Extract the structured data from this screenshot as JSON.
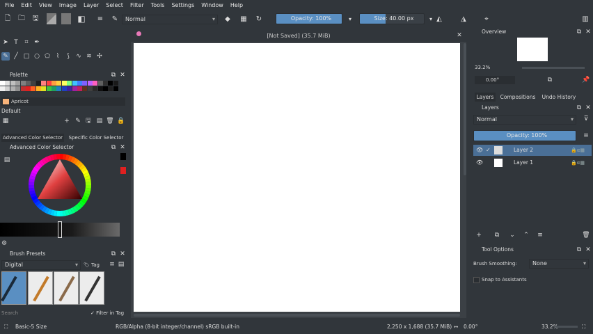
{
  "menu": [
    "File",
    "Edit",
    "View",
    "Image",
    "Layer",
    "Select",
    "Filter",
    "Tools",
    "Settings",
    "Window",
    "Help"
  ],
  "toolbar": {
    "blend_mode": "Normal",
    "opacity_label": "Opacity: 100%",
    "opacity_value": 1.0,
    "size_label": "Size: 40.00 px"
  },
  "document_tab": "[Not Saved]  (35.7 MiB)",
  "palette": {
    "title": "Palette",
    "selected_color_name": "Apricot",
    "preset_label": "Default"
  },
  "color_selector": {
    "tabs": [
      "Advanced Color Selector",
      "Specific Color Selector"
    ],
    "title": "Advanced Color Selector"
  },
  "brush_presets": {
    "title": "Brush Presets",
    "tag_combo": "Digital",
    "tag_label": "Tag",
    "search_placeholder": "Search",
    "filter_label": "Filter in Tag",
    "filter_checked": true
  },
  "overview": {
    "title": "Overview",
    "zoom": "33.2%",
    "rotation": "0.00°"
  },
  "right_tabs": [
    "Layers",
    "Compositions",
    "Undo History"
  ],
  "layers": {
    "title": "Layers",
    "blend_mode": "Normal",
    "opacity_label": "Opacity: 100%",
    "items": [
      {
        "name": "Layer 2",
        "selected": true
      },
      {
        "name": "Layer 1",
        "selected": false
      }
    ]
  },
  "tool_options": {
    "title": "Tool Options",
    "smoothing_label": "Brush Smoothing:",
    "smoothing_value": "None",
    "snap_label": "Snap to Assistants"
  },
  "status": {
    "brush": "Basic-5 Size",
    "color_space": "RGB/Alpha (8-bit integer/channel)  sRGB built-in",
    "dimensions": "2,250 x 1,688 (35.7 MiB)",
    "rotation": "0.00°",
    "zoom": "33.2%"
  },
  "colors": {
    "accent": "#5a8fc2",
    "bg": "#31363b",
    "selected_layer": "#4a6f96"
  }
}
